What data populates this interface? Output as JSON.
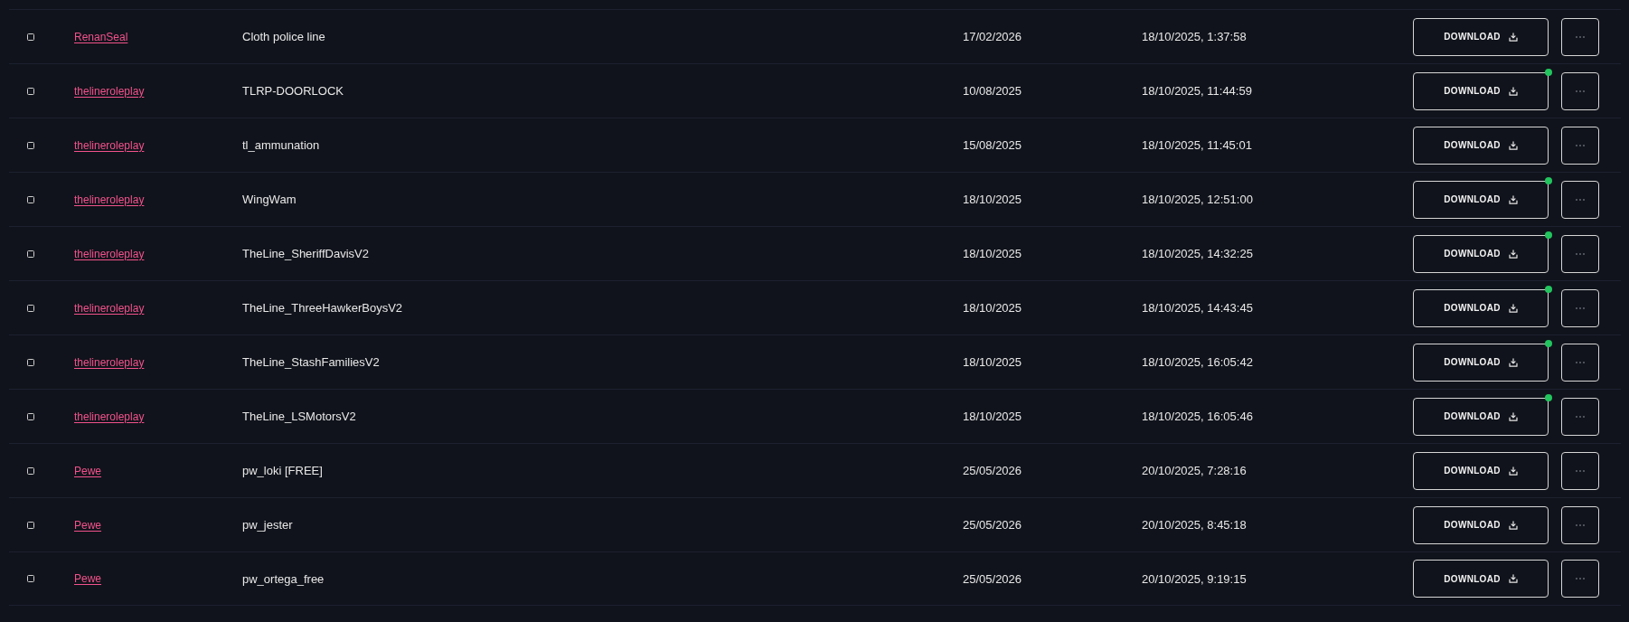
{
  "rows": [
    {
      "checked": false,
      "author": "RenanSeal",
      "name": "Cloth police line",
      "date": "17/02/2026",
      "timestamp": "18/10/2025, 1:37:58",
      "action": "DOWNLOAD",
      "update_dot": false
    },
    {
      "checked": false,
      "author": "thelineroleplay",
      "name": "TLRP-DOORLOCK",
      "date": "10/08/2025",
      "timestamp": "18/10/2025, 11:44:59",
      "action": "DOWNLOAD",
      "update_dot": true
    },
    {
      "checked": false,
      "author": "thelineroleplay",
      "name": "tl_ammunation",
      "date": "15/08/2025",
      "timestamp": "18/10/2025, 11:45:01",
      "action": "DOWNLOAD",
      "update_dot": false
    },
    {
      "checked": false,
      "author": "thelineroleplay",
      "name": "WingWam",
      "date": "18/10/2025",
      "timestamp": "18/10/2025, 12:51:00",
      "action": "DOWNLOAD",
      "update_dot": true
    },
    {
      "checked": false,
      "author": "thelineroleplay",
      "name": "TheLine_SheriffDavisV2",
      "date": "18/10/2025",
      "timestamp": "18/10/2025, 14:32:25",
      "action": "DOWNLOAD",
      "update_dot": true
    },
    {
      "checked": false,
      "author": "thelineroleplay",
      "name": "TheLine_ThreeHawkerBoysV2",
      "date": "18/10/2025",
      "timestamp": "18/10/2025, 14:43:45",
      "action": "DOWNLOAD",
      "update_dot": true
    },
    {
      "checked": false,
      "author": "thelineroleplay",
      "name": "TheLine_StashFamiliesV2",
      "date": "18/10/2025",
      "timestamp": "18/10/2025, 16:05:42",
      "action": "DOWNLOAD",
      "update_dot": true
    },
    {
      "checked": false,
      "author": "thelineroleplay",
      "name": "TheLine_LSMotorsV2",
      "date": "18/10/2025",
      "timestamp": "18/10/2025, 16:05:46",
      "action": "DOWNLOAD",
      "update_dot": true
    },
    {
      "checked": false,
      "author": "Pewe",
      "name": "pw_loki [FREE]",
      "date": "25/05/2026",
      "timestamp": "20/10/2025, 7:28:16",
      "action": "DOWNLOAD",
      "update_dot": false
    },
    {
      "checked": false,
      "author": "Pewe",
      "name": "pw_jester",
      "date": "25/05/2026",
      "timestamp": "20/10/2025, 8:45:18",
      "action": "DOWNLOAD",
      "update_dot": false
    },
    {
      "checked": false,
      "author": "Pewe",
      "name": "pw_ortega_free",
      "date": "25/05/2026",
      "timestamp": "20/10/2025, 9:19:15",
      "action": "DOWNLOAD",
      "update_dot": false
    }
  ]
}
